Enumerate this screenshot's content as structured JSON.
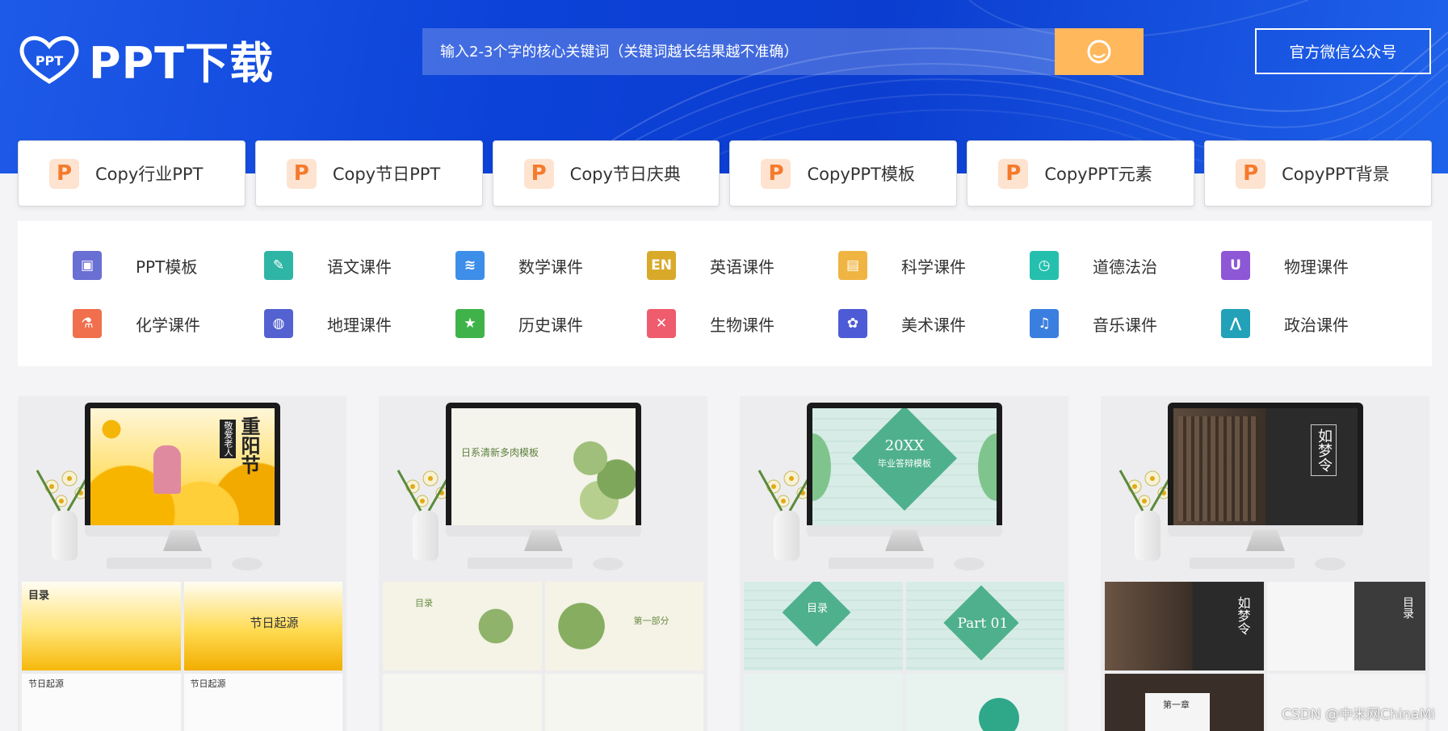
{
  "header": {
    "logo_mark": "PPT",
    "logo_text": "PPT下载",
    "search_placeholder": "输入2-3个字的核心关键词（关键词越长结果越不准确）",
    "wechat_button": "官方微信公众号"
  },
  "categories": [
    {
      "icon": "P",
      "label": "Copy行业PPT"
    },
    {
      "icon": "P",
      "label": "Copy节日PPT"
    },
    {
      "icon": "P",
      "label": "Copy节日庆典"
    },
    {
      "icon": "P",
      "label": "CopyPPT模板"
    },
    {
      "icon": "P",
      "label": "CopyPPT元素"
    },
    {
      "icon": "P",
      "label": "CopyPPT背景"
    }
  ],
  "subjects": [
    {
      "label": "PPT模板",
      "icon": "slides-icon",
      "color": "#6a6fd3",
      "glyph": "▣"
    },
    {
      "label": "语文课件",
      "icon": "leaf-icon",
      "color": "#2fb5a5",
      "glyph": "✎"
    },
    {
      "label": "数学课件",
      "icon": "layers-icon",
      "color": "#3d8ee8",
      "glyph": "≋"
    },
    {
      "label": "英语课件",
      "icon": "en-icon",
      "color": "#d9a92a",
      "glyph": "EN"
    },
    {
      "label": "科学课件",
      "icon": "board-icon",
      "color": "#f0b443",
      "glyph": "▤"
    },
    {
      "label": "道德法治",
      "icon": "calendar-icon",
      "color": "#25c0ad",
      "glyph": "◷"
    },
    {
      "label": "物理课件",
      "icon": "magnet-icon",
      "color": "#8e57d6",
      "glyph": "U"
    },
    {
      "label": "化学课件",
      "icon": "tube-icon",
      "color": "#f06f4d",
      "glyph": "⚗"
    },
    {
      "label": "地理课件",
      "icon": "globe-icon",
      "color": "#5462d1",
      "glyph": "◍"
    },
    {
      "label": "历史课件",
      "icon": "star-icon",
      "color": "#3fb34a",
      "glyph": "★"
    },
    {
      "label": "生物课件",
      "icon": "dna-icon",
      "color": "#ef5c6d",
      "glyph": "✕"
    },
    {
      "label": "美术课件",
      "icon": "palette-icon",
      "color": "#4d5bd6",
      "glyph": "✿"
    },
    {
      "label": "音乐课件",
      "icon": "music-icon",
      "color": "#3a7fe0",
      "glyph": "♫"
    },
    {
      "label": "政治课件",
      "icon": "compass-icon",
      "color": "#22a1b8",
      "glyph": "⋀"
    }
  ],
  "templates": [
    {
      "screen_title": "重阳节",
      "screen_sub": "敬爱老人",
      "thumb_labels": [
        "目录",
        "节日起源",
        "节日起源",
        "节日起源"
      ]
    },
    {
      "screen_title": "日系清新多肉模板",
      "screen_sub": "",
      "thumb_labels": [
        "目录",
        "第一部分",
        "",
        ""
      ]
    },
    {
      "screen_title": "20XX",
      "screen_sub": "毕业答辩模板",
      "thumb_labels": [
        "目录",
        "Part 01",
        "",
        ""
      ]
    },
    {
      "screen_title": "如梦令",
      "screen_sub": "",
      "thumb_labels": [
        "如梦令",
        "目录",
        "第一章",
        ""
      ]
    }
  ],
  "watermark": "CSDN @中米网ChinaMi",
  "colors": {
    "hero": "#0b3dd0",
    "search_button": "#ffb85c",
    "p_icon_bg": "#fde3d0",
    "p_icon_fg": "#f57a2c"
  }
}
